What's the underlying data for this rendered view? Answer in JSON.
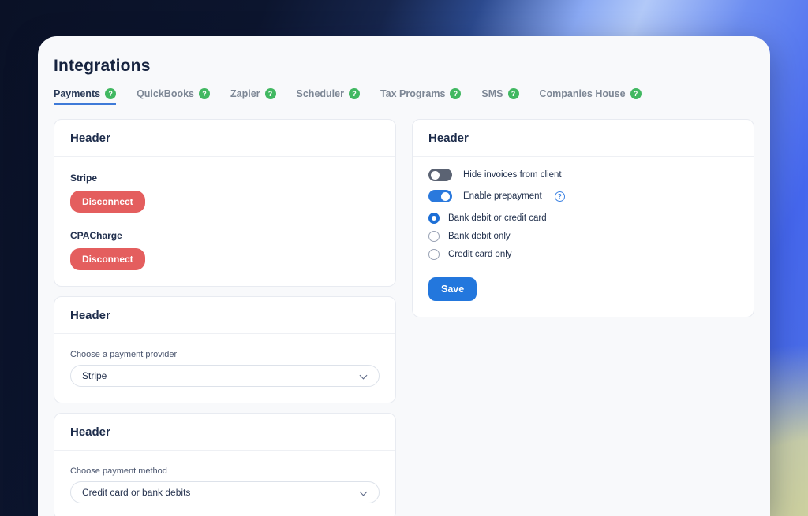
{
  "header": {
    "title": "Integrations"
  },
  "tabs": {
    "badge_glyph": "?",
    "items": [
      {
        "label": "Payments",
        "active": true
      },
      {
        "label": "QuickBooks",
        "active": false
      },
      {
        "label": "Zapier",
        "active": false
      },
      {
        "label": "Scheduler",
        "active": false
      },
      {
        "label": "Tax Programs",
        "active": false
      },
      {
        "label": "SMS",
        "active": false
      },
      {
        "label": "Companies House",
        "active": false
      }
    ]
  },
  "cards": {
    "connected_providers": {
      "header": "Header",
      "providers": [
        {
          "name": "Stripe",
          "action_label": "Disconnect"
        },
        {
          "name": "CPACharge",
          "action_label": "Disconnect"
        }
      ]
    },
    "payment_provider": {
      "header": "Header",
      "label": "Choose a payment provider",
      "selected_value": "Stripe"
    },
    "payment_method": {
      "header": "Header",
      "label": "Choose payment method",
      "selected_value": "Credit card or bank debits"
    },
    "invoice_settings": {
      "header": "Header",
      "toggles": [
        {
          "label": "Hide invoices from client",
          "state": "off"
        },
        {
          "label": "Enable prepayment",
          "state": "on",
          "has_help": true
        }
      ],
      "help_icon_glyph": "?",
      "radios": [
        {
          "label": "Bank debit or credit card",
          "selected": true
        },
        {
          "label": "Bank debit only",
          "selected": false
        },
        {
          "label": "Credit card only",
          "selected": false
        }
      ],
      "save_label": "Save"
    }
  },
  "colors": {
    "accent_blue": "#2377dd",
    "danger_red": "#e45e5e",
    "badge_green": "#41b861",
    "tab_underline": "#3e7ad8",
    "panel_bg": "#f8f9fb"
  }
}
